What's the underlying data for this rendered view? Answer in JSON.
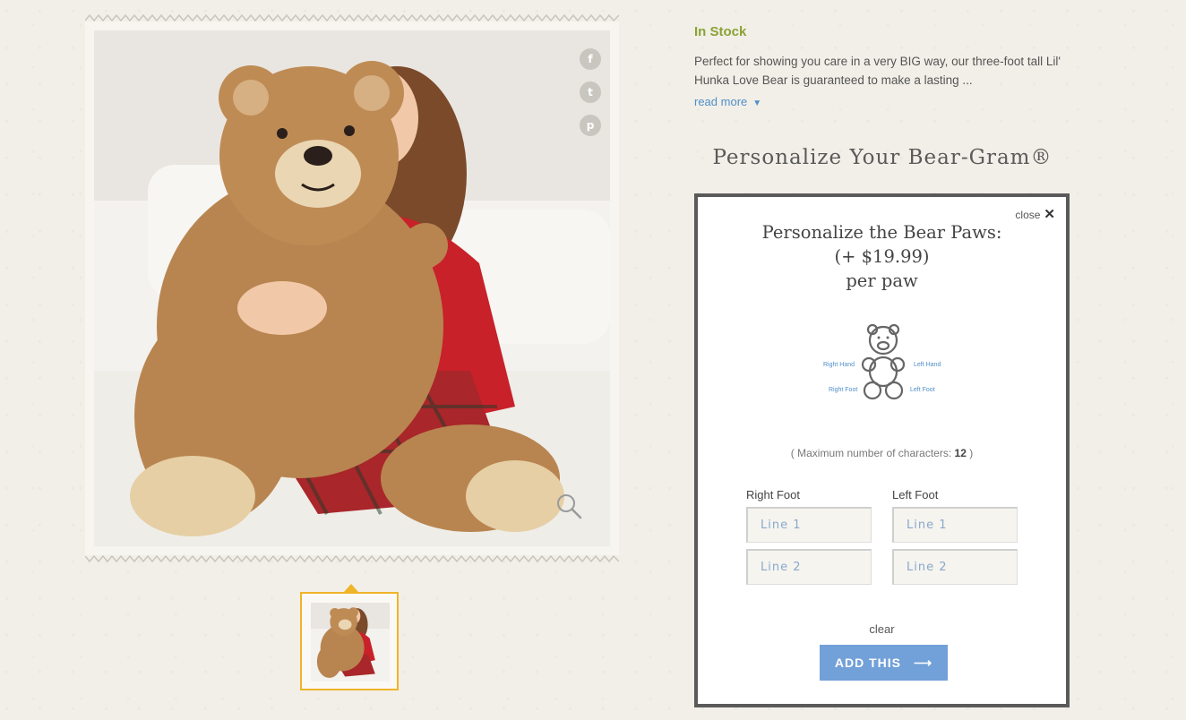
{
  "product": {
    "stock_status": "In Stock",
    "description": "Perfect for showing you care in a very BIG way, our three-foot tall Lil' Hunka Love Bear is guaranteed to make a lasting ...",
    "read_more": "read more",
    "personalize_title": "Personalize Your Bear-Gram®"
  },
  "gallery": {
    "social": {
      "facebook": "f",
      "twitter": "t",
      "pinterest": "p"
    },
    "icons": [
      "facebook-icon",
      "twitter-icon",
      "pinterest-icon",
      "zoom-icon"
    ]
  },
  "modal": {
    "close_label": "close",
    "close_symbol": "✕",
    "title_line1": "Personalize the Bear Paws:",
    "title_line2": "(+ $19.99)",
    "title_line3": "per paw",
    "paws": {
      "right_hand": "Right Hand",
      "left_hand": "Left Hand",
      "right_foot": "Right Foot",
      "left_foot": "Left Foot"
    },
    "max_chars_prefix": "( Maximum number of characters:",
    "max_chars_value": "12",
    "max_chars_suffix": ")",
    "right_foot_label": "Right Foot",
    "left_foot_label": "Left Foot",
    "fields": {
      "right_line1_placeholder": "Line 1",
      "right_line2_placeholder": "Line 2",
      "left_line1_placeholder": "Line 1",
      "left_line2_placeholder": "Line 2"
    },
    "clear_label": "clear",
    "add_button_label": "ADD THIS",
    "add_button_arrow": "⟶"
  },
  "colors": {
    "stock_green": "#8aa234",
    "link_blue": "#4f8fc9",
    "button_blue": "#72a0d8",
    "thumb_border": "#f0b429"
  }
}
